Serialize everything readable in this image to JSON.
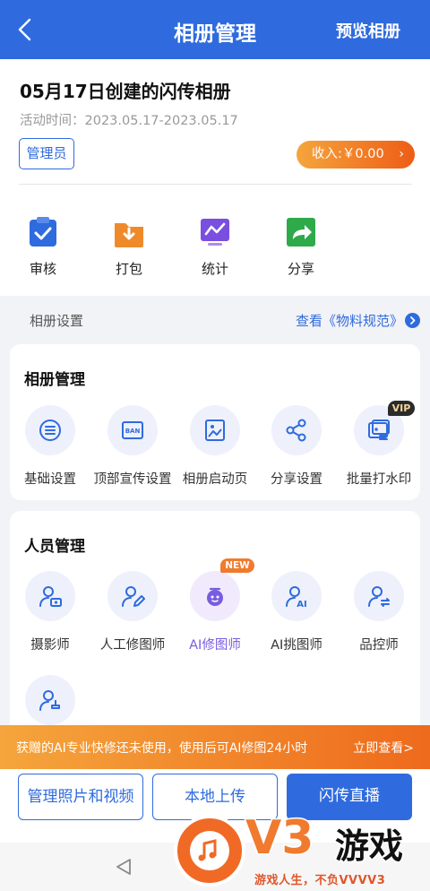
{
  "header": {
    "title": "相册管理",
    "preview": "预览相册"
  },
  "album": {
    "title": "05月17日创建的闪传相册",
    "activity_time": "活动时间：2023.05.17-2023.05.17",
    "admin_badge": "管理员",
    "income": "收入:￥0.00"
  },
  "quick_actions": [
    {
      "label": "审核",
      "icon": "review-icon",
      "color": "#2f6bde"
    },
    {
      "label": "打包",
      "icon": "package-icon",
      "color": "#ef8a2b"
    },
    {
      "label": "统计",
      "icon": "statistics-icon",
      "color": "#7a4fe0"
    },
    {
      "label": "分享",
      "icon": "share-icon",
      "color": "#2eaa4b"
    }
  ],
  "settings": {
    "label": "相册设置",
    "link": "查看《物料规范》"
  },
  "album_mgmt": {
    "title": "相册管理",
    "items": [
      {
        "label": "基础设置",
        "icon": "list-icon"
      },
      {
        "label": "顶部宣传设置",
        "icon": "banner-icon"
      },
      {
        "label": "相册启动页",
        "icon": "image-icon"
      },
      {
        "label": "分享设置",
        "icon": "share-nodes-icon"
      },
      {
        "label": "批量打水印",
        "icon": "watermark-icon",
        "badge": "VIP"
      }
    ]
  },
  "staff_mgmt": {
    "title": "人员管理",
    "items": [
      {
        "label": "摄影师",
        "icon": "photographer-icon"
      },
      {
        "label": "人工修图师",
        "icon": "retoucher-icon"
      },
      {
        "label": "AI修图师",
        "icon": "ai-retouch-icon",
        "badge": "NEW"
      },
      {
        "label": "AI挑图师",
        "icon": "ai-picker-icon"
      },
      {
        "label": "品控师",
        "icon": "quality-control-icon"
      },
      {
        "label": "",
        "icon": "user-stamp-icon"
      }
    ]
  },
  "promo": {
    "text": "获赠的AI专业快修还未使用，使用后可AI修图24小时",
    "action": "立即查看>"
  },
  "buttons": {
    "manage": "管理照片和视频",
    "upload": "本地上传",
    "live": "闪传直播"
  },
  "watermark": {
    "brand": "V3",
    "brand_cn": "游戏",
    "slogan": "游戏人生，不负VVVV3"
  },
  "colors": {
    "primary": "#2f6bde",
    "accent_orange": "#ee5d16",
    "ai_purple": "#7a5ce0"
  }
}
